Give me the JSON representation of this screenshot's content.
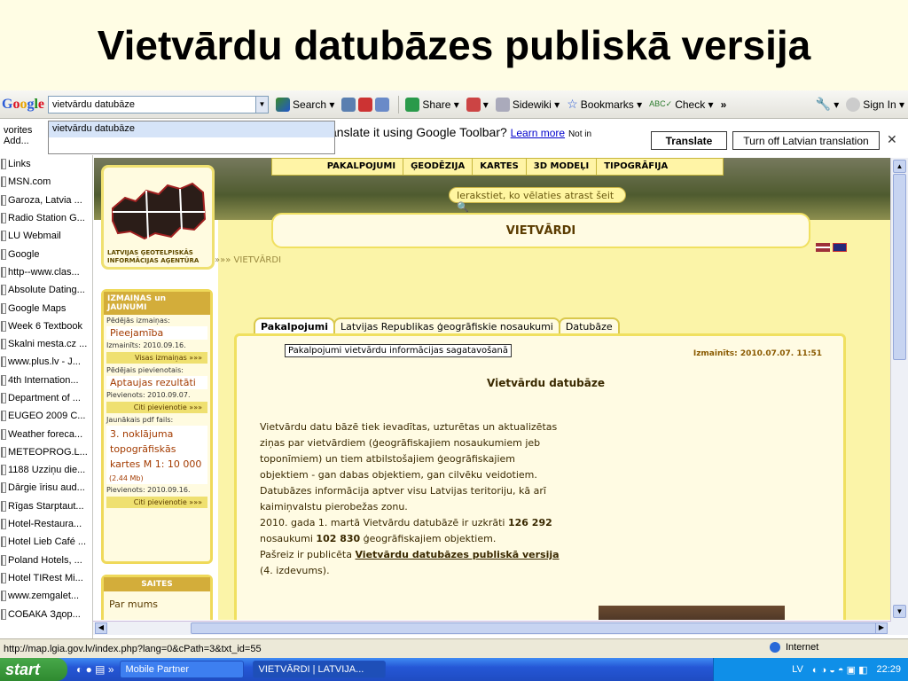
{
  "slide_title": "Vietvārdu datubāzes publiskā versija",
  "toolbar": {
    "search_value": "vietvārdu datubāze",
    "suggestion": "vietvārdu datubāze",
    "items": [
      "Search",
      "Share",
      "Sidewiki",
      "Bookmarks",
      "Check",
      "»",
      "Sign In"
    ]
  },
  "translate_bar": {
    "left_text_1": "vorites",
    "left_text_2": "Add...",
    "question": "anslate it using Google Toolbar?",
    "learn_more": "Learn more",
    "not_in": "Not in",
    "translate_btn": "Translate",
    "turn_off_btn": "Turn off Latvian translation",
    "close": "✕"
  },
  "sidebar": [
    "Links",
    "MSN.com",
    "Garoza, Latvia ...",
    "Radio Station G...",
    "LU Webmail",
    "Google",
    "http--www.clas...",
    "Absolute Dating...",
    "Google Maps",
    "Week 6 Textbook",
    "Skalni mesta.cz ...",
    "www.plus.lv - J...",
    "4th Internation...",
    "Department of ...",
    "EUGEO 2009 C...",
    "Weather foreca...",
    "METEOPROG.L...",
    "1188 Uzziņu die...",
    "Dārgie īrisu aud...",
    "Rīgas Starptaut...",
    "Hotel-Restaura...",
    "Hotel Lieb Café ...",
    "Poland Hotels, ...",
    "Hotel TIRest Mi...",
    "www.zemgalet...",
    "СОБАКА Здор..."
  ],
  "page": {
    "menu": [
      "PAKALPOJUMI",
      "ĢEODĒZIJA",
      "KARTES",
      "3D MODEĻI",
      "TIPOGRĀFIJA"
    ],
    "search_placeholder": "Ierakstiet, ko vēlaties atrast šeit",
    "banner": "VIETVĀRDI",
    "logo_text": "LATVIJAS ĢEOTELPISKĀS INFORMĀCIJAS AĢENTŪRA",
    "breadcrumb": "»»» VIETVĀRDI",
    "left_panel": {
      "header": "IZMAIŅAS un JAUNUMI",
      "l1": "Pēdējās izmaiņas:",
      "v1": "Pieejamība",
      "l2": "Izmainīts: 2010.09.16.",
      "m1": "Visas izmaiņas »»»",
      "l3": "Pēdējais pievienotais:",
      "v2": "Aptaujas rezultāti",
      "l4": "Pievienots: 2010.09.07.",
      "m2": "Citi pievienotie »»»",
      "l5": "Jaunākais pdf fails:",
      "v3": "3. noklājuma topogrāfiskās kartes M 1: 10 000",
      "size": "(2.44 Mb)",
      "l6": "Pievienots: 2010.09.16.",
      "m3": "Citi pievienotie »»»"
    },
    "links_panel": {
      "header": "SAITES",
      "item": "Par mums"
    },
    "tabs": [
      "Pakalpojumi",
      "Latvijas Republikas ģeogrāfiskie nosaukumi",
      "Datubāze"
    ],
    "tooltip": "Pakalpojumi vietvārdu informācijas sagatavošanā",
    "date": "Izmainīts: 2010.07.07. 11:51",
    "heading": "Vietvārdu datubāze",
    "para1": "Vietvārdu datu bāzē tiek ievadītas, uzturētas un aktualizētas ziņas par vietvārdiem (ģeogrāfiskajiem nosaukumiem jeb toponīmiem) un tiem atbilstošajiem ģeogrāfiskajiem objektiem - gan dabas objektiem, gan cilvēku veidotiem.",
    "para2": "Datubāzes informācija aptver visu Latvijas teritoriju, kā arī kaimiņvalstu pierobežas zonu.",
    "para3_a": "2010. gada 1. martā Vietvārdu datubāzē ir uzkrāti ",
    "num1": "126 292",
    "para3_b": " nosaukumi ",
    "num2": "102 830",
    "para3_c": " ģeogrāfiskajiem objektiem.",
    "para4_a": "Pašreiz ir publicēta ",
    "link": "Vietvārdu datubāzes publiskā versija",
    "para4_b": " (4. izdevums)."
  },
  "status": {
    "url": "http://map.lgia.gov.lv/index.php?lang=0&cPath=3&txt_id=55",
    "zone": "Internet"
  },
  "taskbar": {
    "start": "start",
    "task1": "Mobile Partner",
    "task2": "VIETVĀRDI | LATVIJA...",
    "lang": "LV",
    "time": "22:29"
  }
}
